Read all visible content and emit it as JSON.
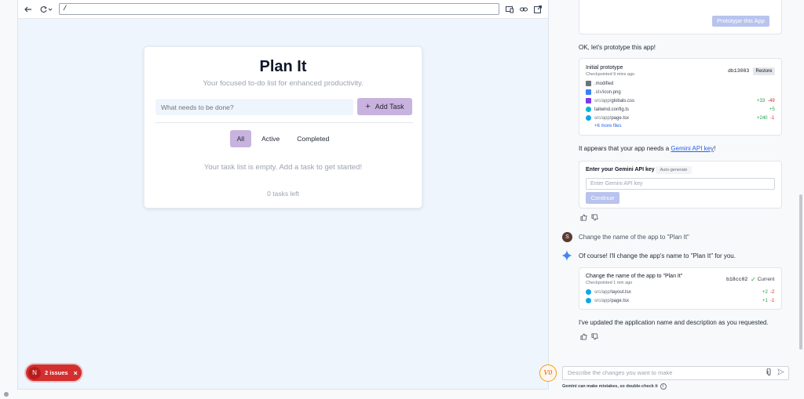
{
  "preview": {
    "url": "/",
    "app": {
      "title": "Plan It",
      "subtitle": "Your focused to-do list for enhanced productivity.",
      "input_placeholder": "What needs to be done?",
      "add_button": "Add Task",
      "filters": [
        "All",
        "Active",
        "Completed"
      ],
      "active_filter": "All",
      "empty_message": "Your task list is empty. Add a task to get started!",
      "tasks_left": "0 tasks left"
    },
    "issues_badge": {
      "letter": "N",
      "label": "2 issues"
    }
  },
  "chat": {
    "prototype_button": "Prototype this App",
    "msg_prototype": "OK, let's prototype this app!",
    "checkpoint1": {
      "title": "Initial prototype",
      "time": "Checkpointed 9 mins ago",
      "hash": "db13083",
      "restore": "Restore",
      "files": [
        {
          "dir": "",
          "name": ".modified",
          "add": "",
          "del": "",
          "icon_color": "#6b7280"
        },
        {
          "dir": ".idx/",
          "name": "icon.png",
          "add": "",
          "del": "",
          "icon_color": "#3b82f6"
        },
        {
          "dir": "src/app/",
          "name": "globals.css",
          "add": "+33",
          "del": "-49",
          "icon_color": "#7c3aed"
        },
        {
          "dir": "",
          "name": "tailwind.config.ts",
          "add": "+5",
          "del": "",
          "icon_color": "#06b6d4"
        },
        {
          "dir": "src/app/",
          "name": "page.tsx",
          "add": "+240",
          "del": "-1",
          "icon_color": "#0ea5e9"
        }
      ],
      "more": "+6 more files"
    },
    "msg_api_pre": "It appears that your app needs a ",
    "msg_api_link": "Gemini API key",
    "msg_api_post": "!",
    "api_key": {
      "title": "Enter your Gemini API key",
      "auto_generate": "Auto-generate",
      "placeholder": "Enter Gemini API key",
      "continue": "Continue"
    },
    "user": {
      "initial": "S",
      "message": "Change the name of the app to \"Plan It\""
    },
    "msg_reply": "Of course! I'll change the app's name to \"Plan It\" for you.",
    "checkpoint2": {
      "title": "Change the name of the app to \"Plan It\"",
      "time": "Checkpointed 1 min ago",
      "hash": "b18cc02",
      "status": "Current",
      "files": [
        {
          "dir": "src/app/",
          "name": "layout.tsx",
          "add": "+2",
          "del": "-2"
        },
        {
          "dir": "src/app/",
          "name": "page.tsx",
          "add": "+1",
          "del": "-1"
        }
      ]
    },
    "msg_done": "I've updated the application name and description as you requested.",
    "input_placeholder": "Describe the changes you want to make",
    "logo": "V0",
    "disclaimer": "Gemini can make mistakes, so double-check it"
  }
}
